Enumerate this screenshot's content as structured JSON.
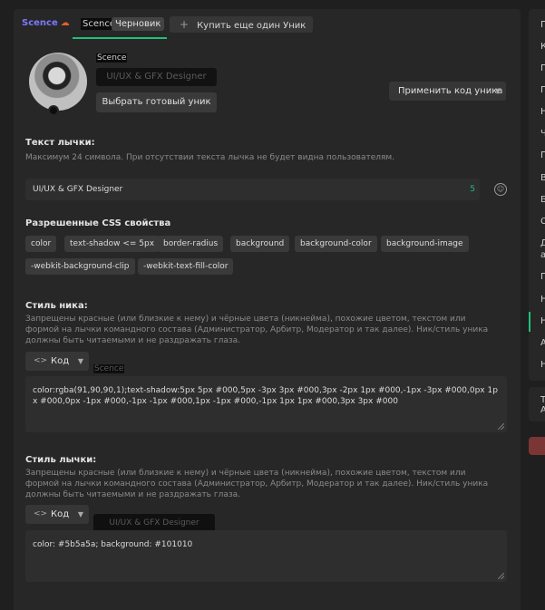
{
  "header": {
    "logo": "Scence",
    "logo_icon": "soundcloud-icon",
    "tab_nick": "Scence",
    "tab_badge": "Черновик",
    "buy_label": "Купить еще один Уник"
  },
  "profile": {
    "nickname": "Scence",
    "user_title": "UI/UX & GFX Designer",
    "choose_label": "Выбрать готовый уник",
    "apply_label": "Применить код уника"
  },
  "badge_text": {
    "label": "Текст лычки:",
    "hint": "Максимум 24 символа. При отсутствии текста лычка не будет видна пользователям.",
    "value": "UI/UX & GFX Designer",
    "remaining": "5"
  },
  "css_props": {
    "label": "Разрешенные CSS свойства",
    "items": [
      "color",
      "text-shadow <= 5px",
      "border-radius",
      "background",
      "background-color",
      "background-image",
      "-webkit-background-clip",
      "-webkit-text-fill-color"
    ]
  },
  "nick_style": {
    "label": "Стиль ника:",
    "hint": "Запрещены красные (или близкие к нему) и чёрные цвета (никнейма), похожие цветом, текстом или формой на лычки командного состава (Администратор, Арбитр, Модератор и так далее). Ник/стиль уника должны быть читаемыми и не раздражать глаза.",
    "code_label": "Код",
    "preview": "Scence",
    "code": "color:rgba(91,90,90,1);text-shadow:5px 5px #000,5px -3px 3px #000,3px -2px 1px #000,-1px -3px #000,0px 1px #000,0px -1px #000,-1px -1px #000,1px -1px #000,-1px 1px 1px #000,3px 3px #000"
  },
  "badge_style": {
    "label": "Стиль лычки:",
    "hint": "Запрещены красные (или близкие к нему) и чёрные цвета (никнейма), похожие цветом, текстом или формой на лычки командного состава (Администратор, Арбитр, Модератор и так далее). Ник/стиль уника должны быть читаемыми и не раздражать глаза.",
    "code_label": "Код",
    "preview": "UI/UX & GFX Designer",
    "code": "color: #5b5a5a; background: #101010"
  },
  "sidebar": {
    "items": [
      "П",
      "К",
      "П",
      "П",
      "Н",
      "Ч",
      "П",
      "В",
      "Б",
      "С",
      "Д",
      "а",
      "П",
      "Н",
      "Н",
      "А",
      "Н"
    ],
    "card_lines": [
      "Т",
      "А"
    ]
  },
  "colors": {
    "accent": "#1fbf7a",
    "nick": "#5b5a5a",
    "panel": "#272727"
  }
}
